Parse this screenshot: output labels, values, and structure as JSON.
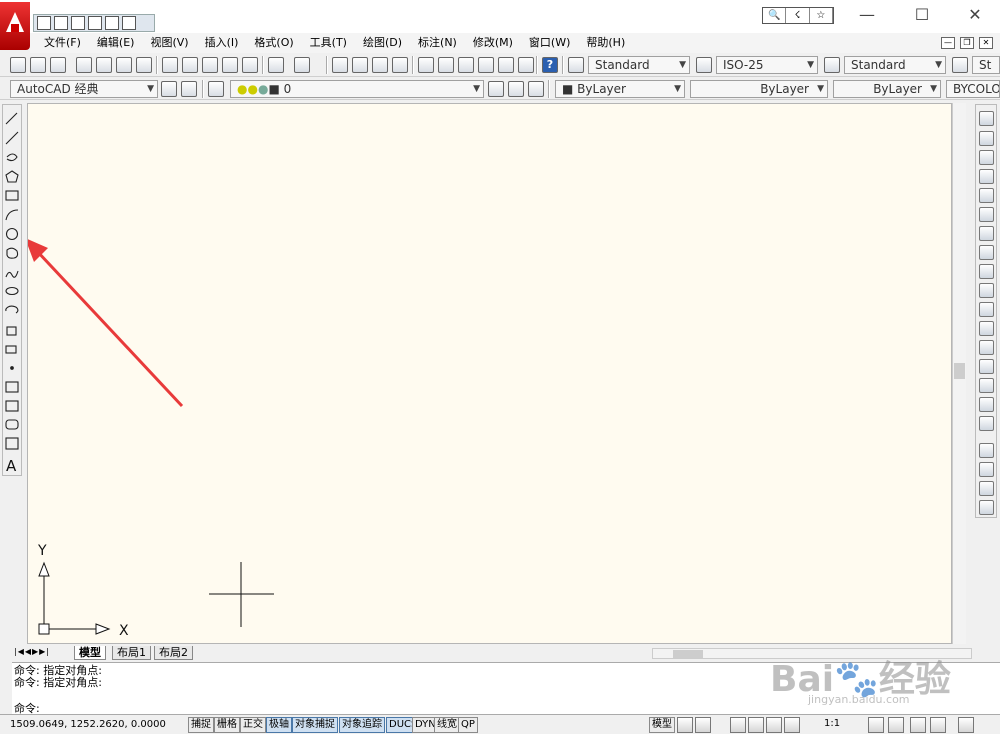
{
  "colors": {
    "canvas_bg": "#fffbf0",
    "arrow": "#e83a3a",
    "logo_red": "#cc1111",
    "status_on": "#cfe0f2"
  },
  "titlebar": {
    "win_min": "—",
    "win_max": "☐",
    "win_close": "✕",
    "infocenter": [
      "🔍",
      "☇",
      "☆"
    ]
  },
  "menubar": {
    "items": [
      "文件(F)",
      "编辑(E)",
      "视图(V)",
      "插入(I)",
      "格式(O)",
      "工具(T)",
      "绘图(D)",
      "标注(N)",
      "修改(M)",
      "窗口(W)",
      "帮助(H)"
    ],
    "doc_min": "—",
    "doc_restore": "❐",
    "doc_close": "✕"
  },
  "toolbar1": {
    "text_style": "Standard",
    "dim_style": "ISO-25",
    "table_style": "Standard",
    "ml_style": "St"
  },
  "toolbar2": {
    "workspace": "AutoCAD 经典",
    "layer": "0",
    "color": "ByLayer",
    "linetype": "ByLayer",
    "lineweight": "ByLayer",
    "plotstyle": "BYCOLOR"
  },
  "left_toolbar": {
    "text_tool": "A"
  },
  "ucs": {
    "y_label": "Y",
    "x_label": "X"
  },
  "tabs": [
    "模型",
    "布局1",
    "布局2"
  ],
  "command": {
    "history": [
      "命令: 指定对角点:",
      "命令: 指定对角点:"
    ],
    "prompt": "命令:"
  },
  "status": {
    "coords": "1509.0649, 1252.2620, 0.0000",
    "buttons": [
      "捕捉",
      "栅格",
      "正交",
      "极轴",
      "对象捕捉",
      "对象追踪",
      "DUCS",
      "DYN",
      "线宽",
      "QP"
    ],
    "model": "模型",
    "scale": "1:1"
  },
  "watermark": {
    "brand": "Bai",
    "brand2": "经验",
    "url": "jingyan.baidu.com"
  }
}
